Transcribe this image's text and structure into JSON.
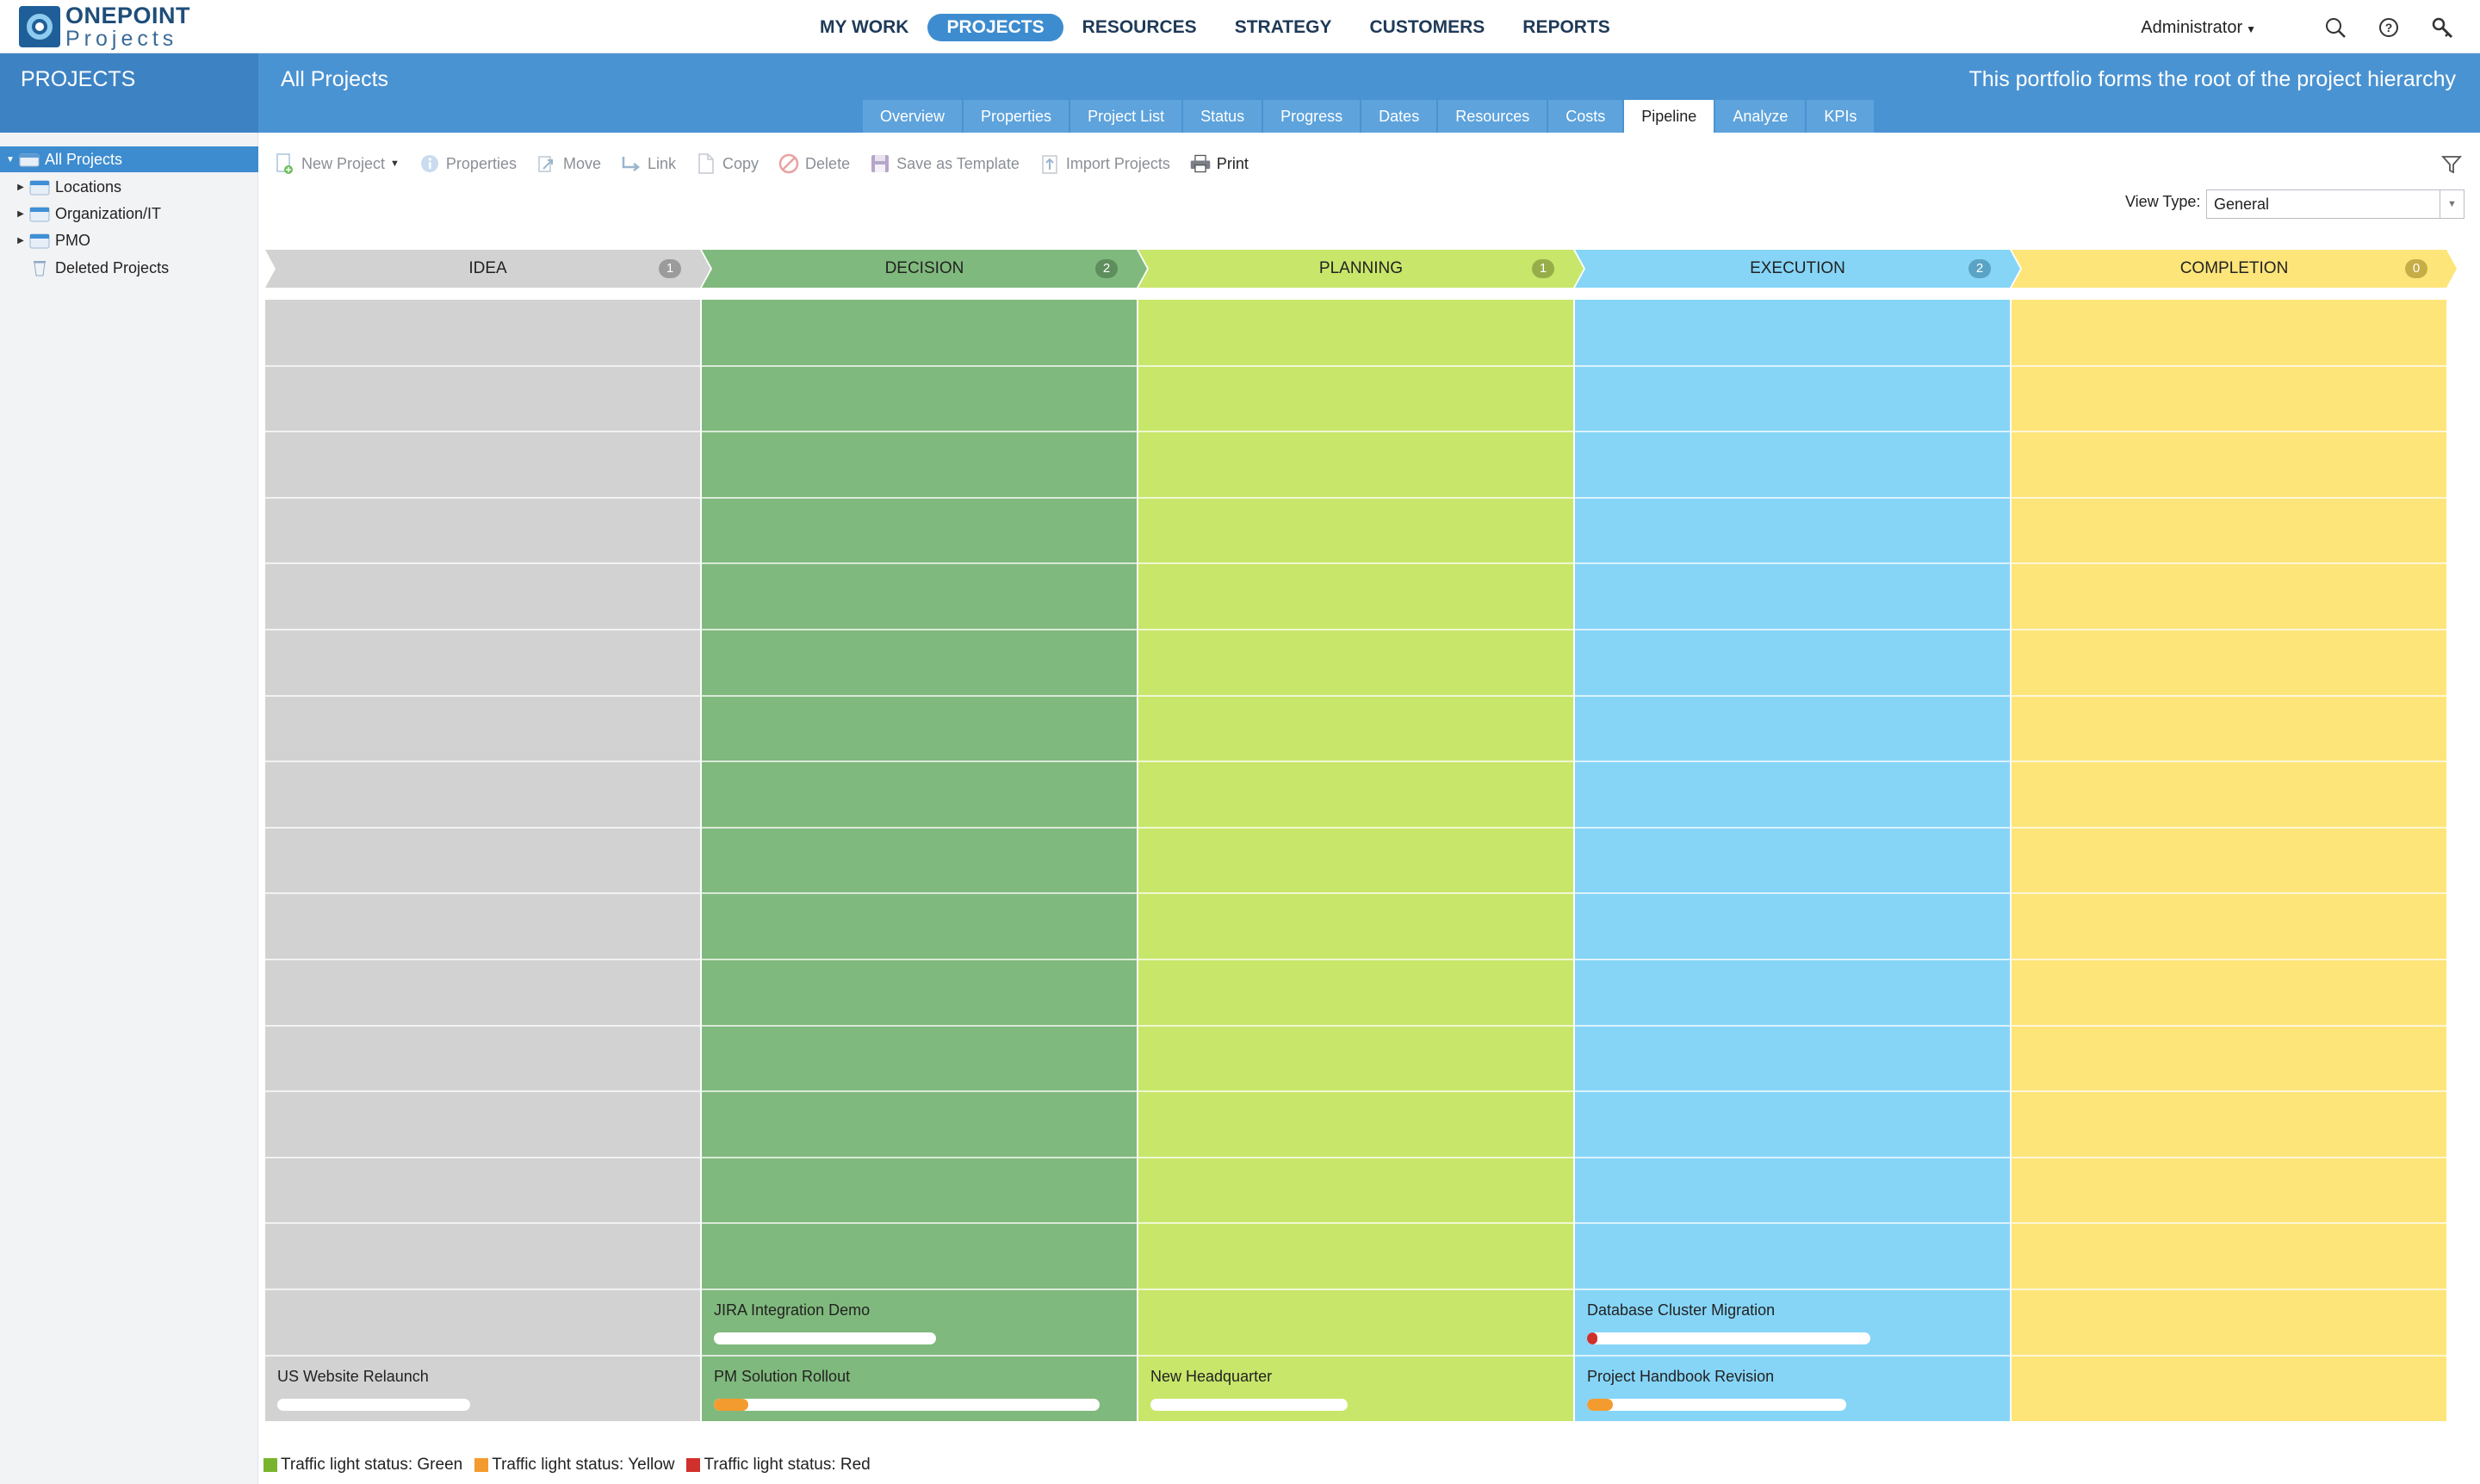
{
  "app": {
    "logo_line1": "ONEPOINT",
    "logo_line2": "Projects"
  },
  "nav": {
    "items": [
      {
        "label": "MY WORK",
        "active": false
      },
      {
        "label": "PROJECTS",
        "active": true
      },
      {
        "label": "RESOURCES",
        "active": false
      },
      {
        "label": "STRATEGY",
        "active": false
      },
      {
        "label": "CUSTOMERS",
        "active": false
      },
      {
        "label": "REPORTS",
        "active": false
      }
    ],
    "user": "Administrator"
  },
  "header": {
    "section": "PROJECTS",
    "title": "All Projects",
    "description": "This portfolio forms the root of the project hierarchy",
    "tabs": [
      {
        "label": "Overview",
        "active": false
      },
      {
        "label": "Properties",
        "active": false
      },
      {
        "label": "Project List",
        "active": false
      },
      {
        "label": "Status",
        "active": false
      },
      {
        "label": "Progress",
        "active": false
      },
      {
        "label": "Dates",
        "active": false
      },
      {
        "label": "Resources",
        "active": false
      },
      {
        "label": "Costs",
        "active": false
      },
      {
        "label": "Pipeline",
        "active": true
      },
      {
        "label": "Analyze",
        "active": false
      },
      {
        "label": "KPIs",
        "active": false
      }
    ]
  },
  "tree": {
    "items": [
      {
        "label": "All Projects",
        "expanded": true,
        "selected": true
      },
      {
        "label": "Locations",
        "expanded": false,
        "selected": false
      },
      {
        "label": "Organization/IT",
        "expanded": false,
        "selected": false
      },
      {
        "label": "PMO",
        "expanded": false,
        "selected": false
      },
      {
        "label": "Deleted Projects",
        "expanded": null,
        "selected": false
      }
    ]
  },
  "toolbar": {
    "new_project": "New Project",
    "properties": "Properties",
    "move": "Move",
    "link": "Link",
    "copy": "Copy",
    "delete": "Delete",
    "save_template": "Save as Template",
    "import": "Import Projects",
    "print": "Print"
  },
  "view_type": {
    "label": "View Type:",
    "value": "General"
  },
  "pipeline": {
    "stages": [
      {
        "name": "IDEA",
        "count": "1",
        "color": "#d2d2d2",
        "header": "#d2d2d2",
        "badge": "#9b9b9b",
        "cards": [
          {
            "name": "US Website Relaunch",
            "slot": 16,
            "bar": 0.47,
            "progress": 0,
            "status": null
          }
        ]
      },
      {
        "name": "DECISION",
        "count": "2",
        "color": "#80b97d",
        "header": "#80b97d",
        "badge": "#5e8e5c",
        "cards": [
          {
            "name": "JIRA Integration Demo",
            "slot": 15,
            "bar": 0.54,
            "progress": 0,
            "status": null
          },
          {
            "name": "PM Solution Rollout",
            "slot": 16,
            "bar": 0.94,
            "progress": 0.09,
            "status": "yellow"
          }
        ]
      },
      {
        "name": "PLANNING",
        "count": "1",
        "color": "#c8e66a",
        "header": "#c8e66a",
        "badge": "#97ad49",
        "cards": [
          {
            "name": "New Headquarter",
            "slot": 16,
            "bar": 0.48,
            "progress": 0,
            "status": null
          }
        ]
      },
      {
        "name": "EXECUTION",
        "count": "2",
        "color": "#86d5f7",
        "header": "#86d5f7",
        "badge": "#5aa3c4",
        "cards": [
          {
            "name": "Database Cluster Migration",
            "slot": 15,
            "bar": 0.69,
            "progress": 0.03,
            "status": "red"
          },
          {
            "name": "Project Handbook Revision",
            "slot": 16,
            "bar": 0.63,
            "progress": 0.1,
            "status": "yellow"
          }
        ]
      },
      {
        "name": "COMPLETION",
        "count": "0",
        "color": "#fee57a",
        "header": "#fee57a",
        "badge": "#c7ad46",
        "cards": []
      }
    ],
    "status_colors": {
      "green": "#78b52c",
      "yellow": "#f39b2e",
      "red": "#d0302b"
    }
  },
  "legend": [
    {
      "label": "Traffic light status: Green",
      "color": "#78b52c"
    },
    {
      "label": "Traffic light status: Yellow",
      "color": "#f39b2e"
    },
    {
      "label": "Traffic light status: Red",
      "color": "#d0302b"
    }
  ]
}
